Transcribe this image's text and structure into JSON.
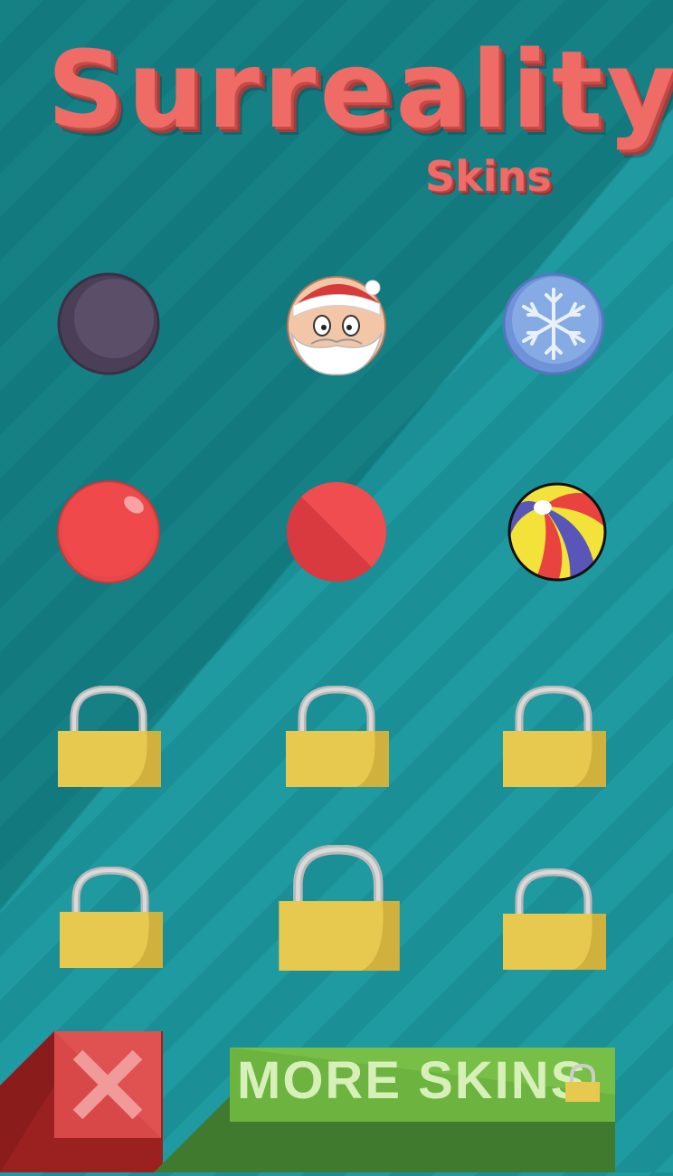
{
  "header": {
    "title": "Surreality",
    "subtitle": "Skins"
  },
  "skins": [
    {
      "icon": "dark-ball-icon",
      "locked": false
    },
    {
      "icon": "santa-ball-icon",
      "locked": false
    },
    {
      "icon": "snowflake-ball-icon",
      "locked": false
    },
    {
      "icon": "red-glossy-ball-icon",
      "locked": false
    },
    {
      "icon": "red-flat-ball-icon",
      "locked": false
    },
    {
      "icon": "beach-ball-icon",
      "locked": false
    },
    {
      "icon": "padlock-icon",
      "locked": true
    },
    {
      "icon": "padlock-icon",
      "locked": true
    },
    {
      "icon": "padlock-icon",
      "locked": true
    },
    {
      "icon": "padlock-icon",
      "locked": true
    },
    {
      "icon": "padlock-icon",
      "locked": true
    },
    {
      "icon": "padlock-icon",
      "locked": true
    }
  ],
  "footer": {
    "close_icon": "close-icon",
    "more_label": "MORE SKINS",
    "more_icon": "padlock-icon"
  },
  "colors": {
    "background": "#1f9aa0",
    "title": "#ef6b66",
    "close_button": "#d84848",
    "more_button": "#6cb33f",
    "padlock_body": "#e8c94f"
  }
}
